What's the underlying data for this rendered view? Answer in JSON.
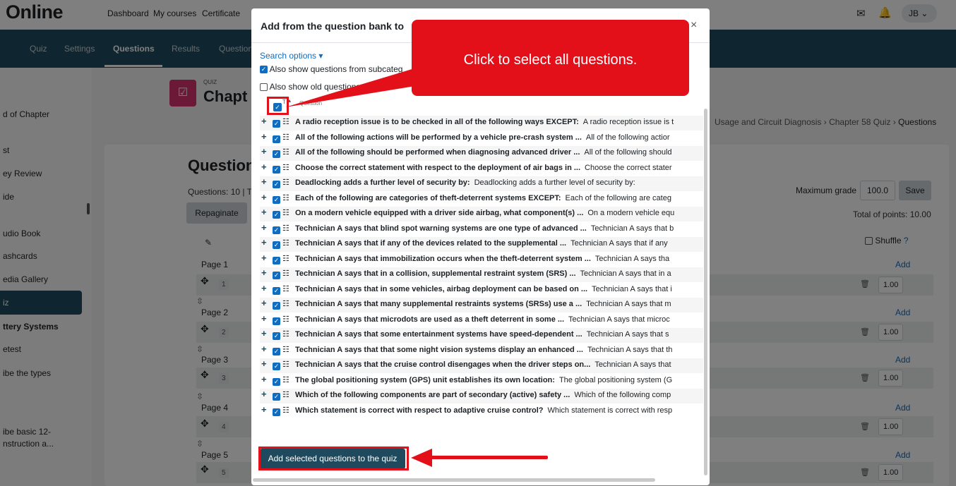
{
  "navbar": {
    "brand": "Online",
    "links": [
      "Dashboard",
      "My courses",
      "Certificate"
    ],
    "user_initials": "JB"
  },
  "subnav": {
    "tabs": [
      "Quiz",
      "Settings",
      "Questions",
      "Results",
      "Question"
    ],
    "active": "Questions"
  },
  "left_drawer": {
    "items": [
      "d of Chapter",
      "st",
      "ey Review",
      "ide",
      "udio Book",
      "ashcards",
      "edia Gallery",
      "iz",
      "ttery Systems",
      "etest",
      "ibe the types",
      "ibe basic 12-",
      "nstruction a..."
    ]
  },
  "page_header": {
    "eyebrow": "QUIZ",
    "title": "Chapt",
    "breadcrumb": [
      "Usage and Circuit Diagnosis",
      "Chapter 58 Quiz",
      "Questions"
    ]
  },
  "questions_panel": {
    "heading": "Question",
    "summary": "Questions: 10 | T",
    "repaginate_label": "Repaginate",
    "max_grade_label": "Maximum grade",
    "max_grade_value": "100.0",
    "save_label": "Save",
    "total_points": "Total of points: 10.00",
    "shuffle_label": "Shuffle",
    "add_label": "Add",
    "pages": [
      {
        "label": "Page 1",
        "num": "1",
        "grade": "1.00"
      },
      {
        "label": "Page 2",
        "num": "2",
        "grade": "1.00"
      },
      {
        "label": "Page 3",
        "num": "3",
        "grade": "1.00"
      },
      {
        "label": "Page 4",
        "num": "4",
        "grade": "1.00"
      },
      {
        "label": "Page 5",
        "num": "5",
        "grade": "1.00"
      }
    ]
  },
  "modal": {
    "title": "Add from the question bank to",
    "search_options": "Search options",
    "show_subcategories": "Also show questions from subcateg",
    "show_old": "Also show old questions",
    "column_t": "T",
    "column_question": "Question",
    "add_selected_label": "Add selected questions to the quiz",
    "questions": [
      {
        "name": "A radio reception issue is to be checked in all of the following ways EXCEPT:",
        "text": "A radio reception issue is t"
      },
      {
        "name": "All of the following actions will be performed by a vehicle pre-crash system ...",
        "text": "All of the following actior"
      },
      {
        "name": "All of the following should be performed when diagnosing advanced driver ...",
        "text": "All of the following should"
      },
      {
        "name": "Choose the correct statement with respect to the deployment of air bags in ...",
        "text": "Choose the correct stater"
      },
      {
        "name": "Deadlocking adds a further level of security by:",
        "text": "Deadlocking adds a further level of security by:"
      },
      {
        "name": "Each of the following are categories of theft-deterrent systems EXCEPT:",
        "text": "Each of the following are categ"
      },
      {
        "name": "On a modern vehicle equipped with a driver side airbag, what component(s) ...",
        "text": "On a modern vehicle equ"
      },
      {
        "name": "Technician A says that blind spot warning systems are one type of advanced ...",
        "text": "Technician A says that b"
      },
      {
        "name": "Technician A says that if any of the devices related to the supplemental ...",
        "text": "Technician A says that if any"
      },
      {
        "name": "Technician A says that immobilization occurs when the theft-deterrent system ...",
        "text": "Technician A says tha"
      },
      {
        "name": "Technician A says that in a collision, supplemental restraint system (SRS) ...",
        "text": "Technician A says that in a"
      },
      {
        "name": "Technician A says that in some vehicles, airbag deployment can be based on ...",
        "text": "Technician A says that i"
      },
      {
        "name": "Technician A says that many supplemental restraints systems (SRSs) use a ...",
        "text": "Technician A says that m"
      },
      {
        "name": "Technician A says that microdots are used as a theft deterrent in some ...",
        "text": "Technician A says that microc"
      },
      {
        "name": "Technician A says that some entertainment systems have speed-dependent ...",
        "text": "Technician A says that s"
      },
      {
        "name": "Technician A says that that some night vision systems display an enhanced ...",
        "text": "Technician A says that th"
      },
      {
        "name": "Technician A says that the cruise control disengages when the driver steps on...",
        "text": "Technician A says that"
      },
      {
        "name": "The global positioning system (GPS) unit establishes its own location:",
        "text": "The global positioning system (G"
      },
      {
        "name": "Which of the following components are part of secondary (active) safety ...",
        "text": "Which of the following comp"
      },
      {
        "name": "Which statement is correct with respect to adaptive cruise control?",
        "text": "Which statement is correct with resp"
      }
    ]
  },
  "callout": {
    "text": "Click to select all questions.",
    "color": "#e3101a"
  },
  "colors": {
    "primary_dark": "#1f4a5e",
    "link": "#0f6cbf",
    "quiz_icon": "#d6336c",
    "highlight": "#e3101a"
  }
}
